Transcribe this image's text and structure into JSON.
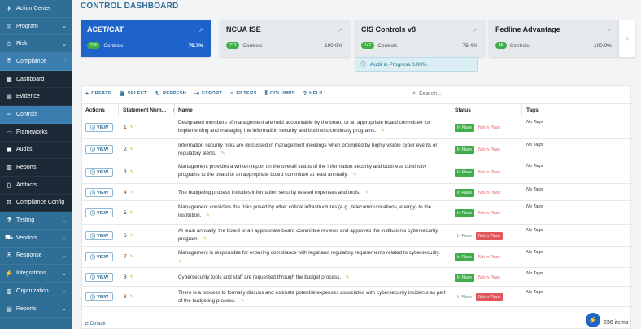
{
  "sidebar": {
    "items": [
      {
        "label": "Action Center",
        "icon": "rocket-icon",
        "chevron": ""
      },
      {
        "label": "Program",
        "icon": "target-icon",
        "chevron": "⌄"
      },
      {
        "label": "Risk",
        "icon": "warning-icon",
        "chevron": "⌄"
      },
      {
        "label": "Compliance",
        "icon": "shield-check-icon",
        "chevron": "⌃"
      },
      {
        "label": "Dashboard",
        "icon": "grid-icon",
        "chevron": ""
      },
      {
        "label": "Evidence",
        "icon": "doc-icon",
        "chevron": ""
      },
      {
        "label": "Controls",
        "icon": "list-icon",
        "chevron": ""
      },
      {
        "label": "Frameworks",
        "icon": "folder-icon",
        "chevron": ""
      },
      {
        "label": "Audits",
        "icon": "clipboard-icon",
        "chevron": ""
      },
      {
        "label": "Reports",
        "icon": "chart-icon",
        "chevron": ""
      },
      {
        "label": "Artifacts",
        "icon": "file-icon",
        "chevron": ""
      },
      {
        "label": "Compliance Config",
        "icon": "gear-icon",
        "chevron": ""
      },
      {
        "label": "Testing",
        "icon": "flask-icon",
        "chevron": "⌄"
      },
      {
        "label": "Vendors",
        "icon": "truck-icon",
        "chevron": "⌄"
      },
      {
        "label": "Response",
        "icon": "shield-icon",
        "chevron": "⌄"
      },
      {
        "label": "Integrations",
        "icon": "plug-icon",
        "chevron": "⌄"
      },
      {
        "label": "Organization",
        "icon": "globe-icon",
        "chevron": "⌄"
      },
      {
        "label": "Reports",
        "icon": "report-icon",
        "chevron": "⌄"
      }
    ]
  },
  "page": {
    "title": "CONTROL DASHBOARD"
  },
  "cards": [
    {
      "title": "ACET/CAT",
      "count": "236",
      "label": "Controls",
      "percent": "79.7%"
    },
    {
      "title": "NCUA ISE",
      "count": "273",
      "label": "Controls",
      "percent": "100.0%"
    },
    {
      "title": "CIS Controls v8",
      "count": "142",
      "label": "Controls",
      "percent": "75.4%"
    },
    {
      "title": "Fedline Advantage",
      "count": "46",
      "label": "Controls",
      "percent": "100.0%"
    }
  ],
  "audit": {
    "text": "Audit in Progress 0.00%"
  },
  "toolbar": {
    "create": "CREATE",
    "select": "SELECT",
    "refresh": "REFRESH",
    "export": "EXPORT",
    "filters": "FILTERS",
    "columns": "COLUMNS",
    "help": "HELP",
    "search_placeholder": "Search..."
  },
  "table": {
    "headers": {
      "actions": "Actions",
      "num": "Statement Num...",
      "name": "Name",
      "status": "Status",
      "tags": "Tags"
    },
    "view_label": "VIEW",
    "in_place_label": "In Place",
    "not_in_place_label": "Not in Place",
    "rows": [
      {
        "num": "1",
        "name": "Designated members of management are held accountable by the board or an appropriate board committee for implementing and managing the information security and business continuity programs.",
        "status": "in",
        "tags": "No Tags"
      },
      {
        "num": "2",
        "name": "Information security risks are discussed in management meetings when prompted by highly visible cyber events or regulatory alerts.",
        "status": "in",
        "tags": "No Tags"
      },
      {
        "num": "3",
        "name": "Management provides a written report on the overall status of the information security and business continuity programs to the board or an appropriate board committee at least annually.",
        "status": "in",
        "tags": "No Tags"
      },
      {
        "num": "4",
        "name": "The budgeting process includes information security related expenses and tools.",
        "status": "in",
        "tags": "No Tags"
      },
      {
        "num": "5",
        "name": "Management considers the risks posed by other critical infrastructures (e.g., telecommunications, energy) to the institution.",
        "status": "in",
        "tags": "No Tags"
      },
      {
        "num": "6",
        "name": "At least annually, the board or an appropriate board committee reviews and approves the institution's cybersecurity program.",
        "status": "not",
        "tags": "No Tags"
      },
      {
        "num": "7",
        "name": "Management is responsible for ensuring compliance with legal and regulatory requirements related to cybersecurity.",
        "status": "in",
        "tags": "No Tags"
      },
      {
        "num": "8",
        "name": "Cybersecurity tools and staff are requested through the budget process.",
        "status": "in",
        "tags": "No Tags"
      },
      {
        "num": "9",
        "name": "There is a process to formally discuss and estimate potential expenses associated with cybersecurity incidents as part of the budgeting process.",
        "status": "not",
        "tags": "No Tags"
      }
    ]
  },
  "footer": {
    "view": "Default",
    "count": "236 items"
  },
  "colors": {
    "sidebar": "#2f6e96",
    "accent": "#1e63c9",
    "in_place": "#3fae49",
    "not_in_place": "#e0585c"
  }
}
